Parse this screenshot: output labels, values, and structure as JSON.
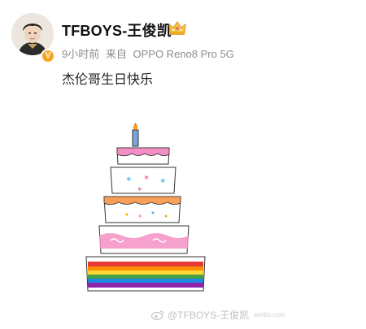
{
  "post": {
    "username": "TFBOYS-王俊凯",
    "time": "9小时前",
    "source_prefix": "来自",
    "source_device": "OPPO Reno8 Pro 5G",
    "text": "杰伦哥生日快乐",
    "verified_badge_color": "#f6a623",
    "icons": {
      "verified": "verified-v-icon",
      "crown": "crown-icon"
    }
  },
  "image": {
    "description_name": "hand-drawn-birthday-cake"
  },
  "watermark": {
    "text": "@TFBOYS-王俊凯",
    "logo": "weibo-logo-icon",
    "handle": "weibo.com"
  },
  "colors": {
    "username": "#111111",
    "meta": "#8c8c8c",
    "cake_pink": "#f48fc5",
    "cake_orange": "#f7a057",
    "rainbow": [
      "#e53935",
      "#fb8c00",
      "#fdd835",
      "#43a047",
      "#1e88e5",
      "#8e24aa"
    ]
  }
}
